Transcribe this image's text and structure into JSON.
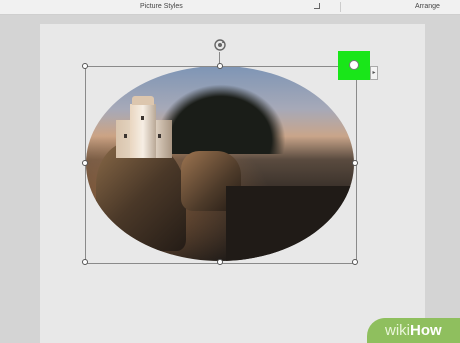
{
  "ribbon": {
    "group_picture_styles": "Picture Styles",
    "group_arrange": "Arrange"
  },
  "image": {
    "description_shape": "ellipse",
    "highlight_color": "#19e619"
  },
  "watermark": {
    "part1": "wiki",
    "part2": "How"
  }
}
